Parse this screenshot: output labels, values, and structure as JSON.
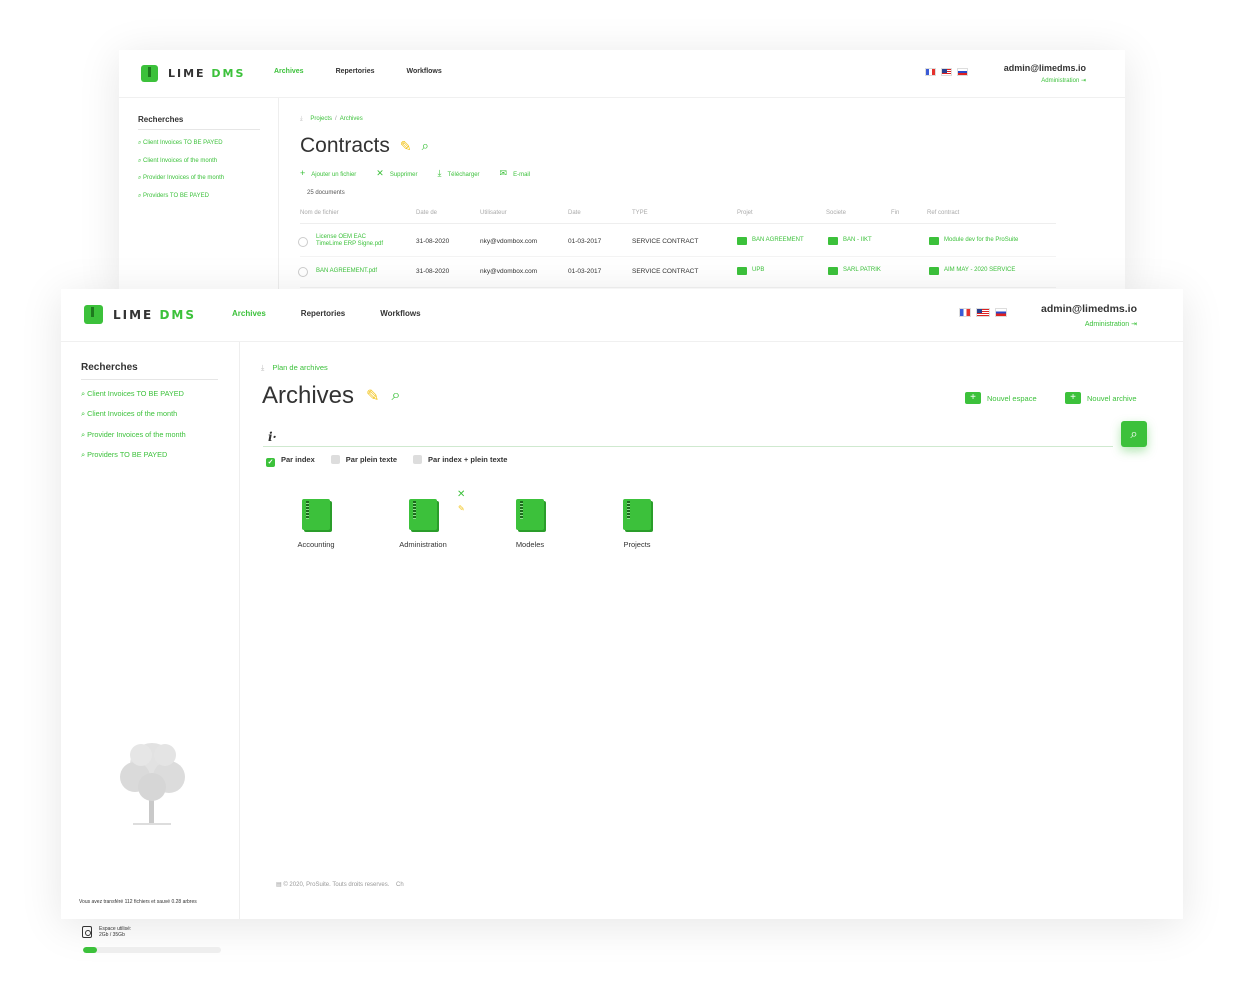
{
  "brand": {
    "word_lime": "LIME",
    "word_dms": "DMS"
  },
  "nav": {
    "archives": "Archives",
    "repertories": "Repertories",
    "workflows": "Workflows"
  },
  "user": {
    "email": "admin@limedms.io",
    "admin_link": "Administration ⇥"
  },
  "flags": [
    "fr-flag",
    "us-flag",
    "ru-flag"
  ],
  "colors": {
    "accent": "#3cc13b",
    "pencil": "#f2c318"
  },
  "sidebar": {
    "title": "Recherches",
    "items": [
      "Client Invoices TO BE PAYED",
      "Client Invoices of the month",
      "Provider Invoices of the month",
      "Providers TO BE PAYED"
    ]
  },
  "back": {
    "breadcrumb": [
      "Projects",
      "Archives"
    ],
    "title": "Contracts",
    "actions": {
      "add": "Ajouter un fichier",
      "delete": "Supprimer",
      "download": "Télécharger",
      "email": "E-mail"
    },
    "count": "25 documents",
    "columns": [
      "Nom de fichier",
      "Date de",
      "Utilisateur",
      "Date",
      "TYPE",
      "Projet",
      "Societe",
      "Fin",
      "Ref contract"
    ],
    "rows": [
      {
        "file_line1": "License OEM EAC",
        "file_line2": "TimeLime ERP Signe.pdf",
        "date_de": "31-08-2020",
        "user": "nky@vdombox.com",
        "date": "01-03-2017",
        "type": "SERVICE CONTRACT",
        "project": "BAN AGREEMENT",
        "company": "BAN - IIKT",
        "ref": "Module dev for the ProSuite"
      },
      {
        "file_line1": "BAN AGREEMENT.pdf",
        "file_line2": "",
        "date_de": "31-08-2020",
        "user": "nky@vdombox.com",
        "date": "01-03-2017",
        "type": "SERVICE CONTRACT",
        "project": "UPB",
        "company": "SARL PATRIK",
        "ref": "AIM MAY - 2020 SERVICE"
      }
    ]
  },
  "front": {
    "breadcrumb": "Plan de archives",
    "title": "Archives",
    "new_space": "Nouvel espace",
    "new_archive": "Nouvel archive",
    "search_placeholder": "",
    "filters": [
      {
        "label": "Par index",
        "checked": true
      },
      {
        "label": "Par plein texte",
        "checked": false
      },
      {
        "label": "Par index + plein texte",
        "checked": false
      }
    ],
    "archives": [
      "Accounting",
      "Administration",
      "Modeles",
      "Projects"
    ],
    "stats": {
      "saved_text": "Vous avez transféré 112 fichiers et sauvé 0.28 arbres",
      "space_label": "Espace utilisé:",
      "space_value": "2Gb / 35Gb",
      "space_fraction": 0.1
    },
    "footer": "© 2020, ProSuite. Touts droits reserves.",
    "footer_lang": "Ch"
  }
}
